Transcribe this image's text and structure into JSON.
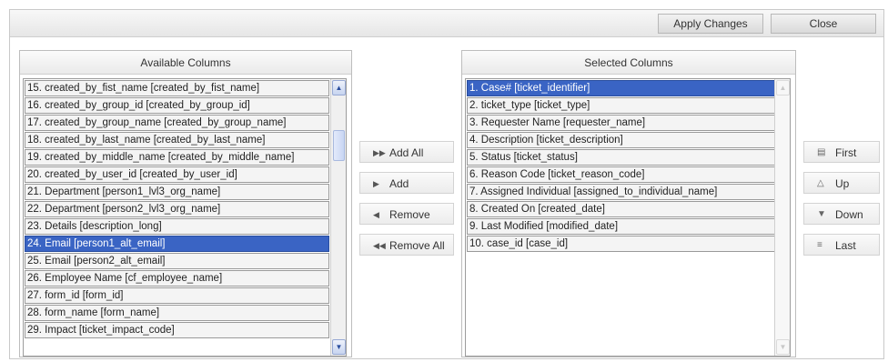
{
  "toolbar": {
    "apply_label": "Apply Changes",
    "close_label": "Close"
  },
  "available": {
    "title": "Available Columns",
    "items": [
      "15. created_by_fist_name [created_by_fist_name]",
      "16. created_by_group_id [created_by_group_id]",
      "17. created_by_group_name [created_by_group_name]",
      "18. created_by_last_name [created_by_last_name]",
      "19. created_by_middle_name [created_by_middle_name]",
      "20. created_by_user_id [created_by_user_id]",
      "21. Department [person1_lvl3_org_name]",
      "22. Department [person2_lvl3_org_name]",
      "23. Details [description_long]",
      "24. Email [person1_alt_email]",
      "25. Email [person2_alt_email]",
      "26. Employee Name [cf_employee_name]",
      "27. form_id [form_id]",
      "28. form_name [form_name]",
      "29. Impact [ticket_impact_code]"
    ],
    "selected_index": 9
  },
  "selected": {
    "title": "Selected Columns",
    "items": [
      "1. Case# [ticket_identifier]",
      "2. ticket_type [ticket_type]",
      "3. Requester Name [requester_name]",
      "4. Description [ticket_description]",
      "5. Status [ticket_status]",
      "6. Reason Code [ticket_reason_code]",
      "7. Assigned Individual [assigned_to_individual_name]",
      "8. Created On [created_date]",
      "9. Last Modified [modified_date]",
      "10. case_id [case_id]"
    ],
    "selected_index": 0
  },
  "transfer": {
    "add_all": "Add All",
    "add": "Add",
    "remove": "Remove",
    "remove_all": "Remove All"
  },
  "order": {
    "first": "First",
    "up": "Up",
    "down": "Down",
    "last": "Last"
  },
  "icons": {
    "add_all": "double-right-arrow-icon",
    "add": "right-arrow-icon",
    "remove": "left-arrow-icon",
    "remove_all": "double-left-arrow-icon",
    "first": "first-icon",
    "up": "up-triangle-icon",
    "down": "down-triangle-icon",
    "last": "last-icon"
  },
  "colors": {
    "selection": "#3a64c4",
    "scroll_accent": "#97a9d4"
  }
}
